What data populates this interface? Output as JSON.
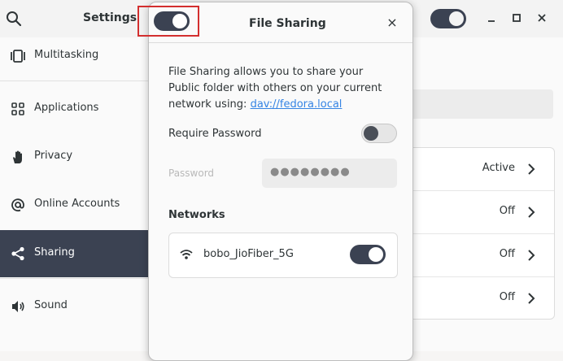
{
  "header": {
    "title": "Settings"
  },
  "sidebar": {
    "items": [
      {
        "label": "Multitasking"
      },
      {
        "label": "Applications"
      },
      {
        "label": "Privacy"
      },
      {
        "label": "Online Accounts"
      },
      {
        "label": "Sharing"
      },
      {
        "label": "Sound"
      }
    ]
  },
  "main": {
    "rows": [
      {
        "value": "Active"
      },
      {
        "value": "Off"
      },
      {
        "value": "Off"
      },
      {
        "value": "Off"
      }
    ]
  },
  "dialog": {
    "title": "File Sharing",
    "close": "×",
    "toggle_on": true,
    "description": "File Sharing allows you to share your Public folder with others on your current network using: ",
    "link": "dav://fedora.local",
    "require_password_label": "Require Password",
    "require_password_on": false,
    "password_placeholder": "Password",
    "password_dots": "●●●●●●●●",
    "networks_title": "Networks",
    "network_name": "bobo_JioFiber_5G",
    "network_on": true
  },
  "colors": {
    "accent_dark": "#3b4252",
    "link": "#3584e4",
    "highlight": "#d32f2f"
  }
}
